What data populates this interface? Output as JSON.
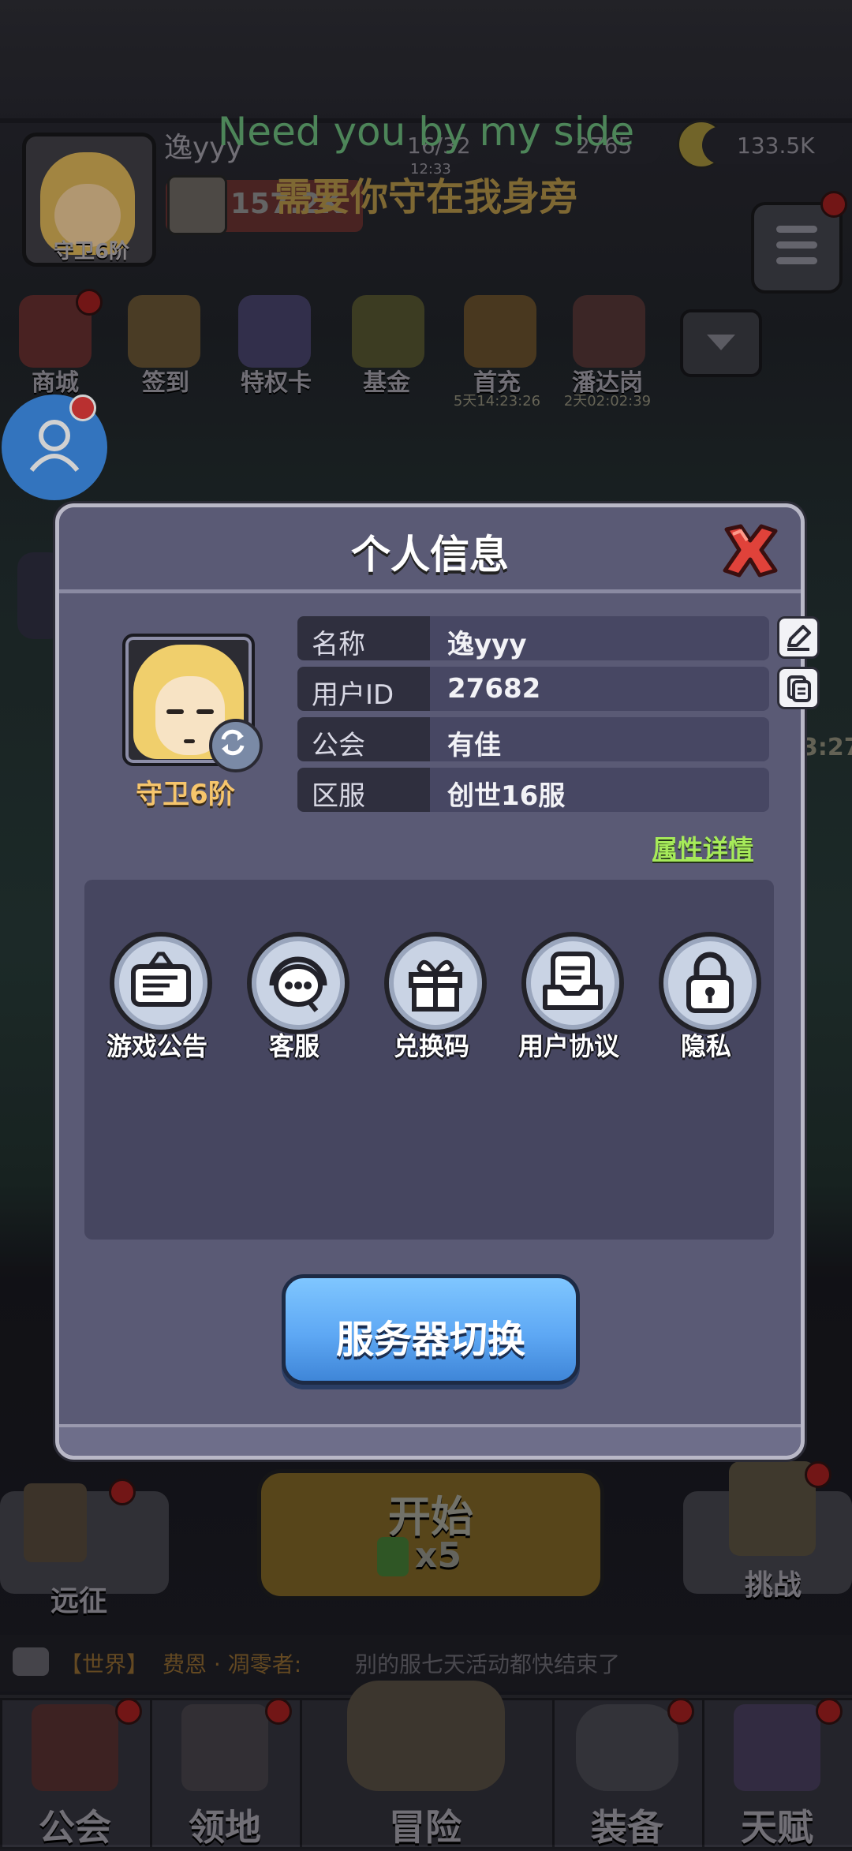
{
  "player": {
    "name": "逸yyy",
    "rank_top": "守卫6阶",
    "power": "157.2K"
  },
  "resources": {
    "stamina": "16/32",
    "stamina_sub": "12:33",
    "gems": "2765",
    "gold": "133.5K"
  },
  "lyrics": {
    "line1": "Need you by my side",
    "line2": "需要你守在我身旁"
  },
  "top_icons": [
    {
      "label": "商城"
    },
    {
      "label": "签到"
    },
    {
      "label": "特权卡"
    },
    {
      "label": "基金"
    },
    {
      "label": "首充",
      "timer": "5天14:23:26"
    },
    {
      "label": "潘达岗",
      "timer": "2天02:02:39"
    }
  ],
  "side_timer": "3:27",
  "modal": {
    "title": "个人信息",
    "avatar_rank": "守卫6阶",
    "rows": [
      {
        "key": "名称",
        "value": "逸yyy"
      },
      {
        "key": "用户ID",
        "value": "27682"
      },
      {
        "key": "公会",
        "value": "有佳"
      },
      {
        "key": "区服",
        "value": "创世16服"
      }
    ],
    "attr_link": "属性详情",
    "functions": [
      {
        "label": "游戏公告"
      },
      {
        "label": "客服"
      },
      {
        "label": "兑换码"
      },
      {
        "label": "用户协议"
      },
      {
        "label": "隐私"
      }
    ],
    "server_switch": "服务器切换"
  },
  "bottom": {
    "expedition": "远征",
    "start": "开始",
    "start_cost": "x5",
    "challenge": "挑战"
  },
  "chat": {
    "channel": "【世界】",
    "sender": "费恩 · 凋零者:",
    "message": "别的服七天活动都快结束了"
  },
  "nav": [
    {
      "label": "公会"
    },
    {
      "label": "领地"
    },
    {
      "label": "冒险"
    },
    {
      "label": "装备"
    },
    {
      "label": "天赋"
    }
  ],
  "colors": {
    "modal_bg": "#5a5a75",
    "accent_blue": "#5ea8f4",
    "link_green": "#a6ea5a",
    "rank_gold": "#f6c56c"
  }
}
